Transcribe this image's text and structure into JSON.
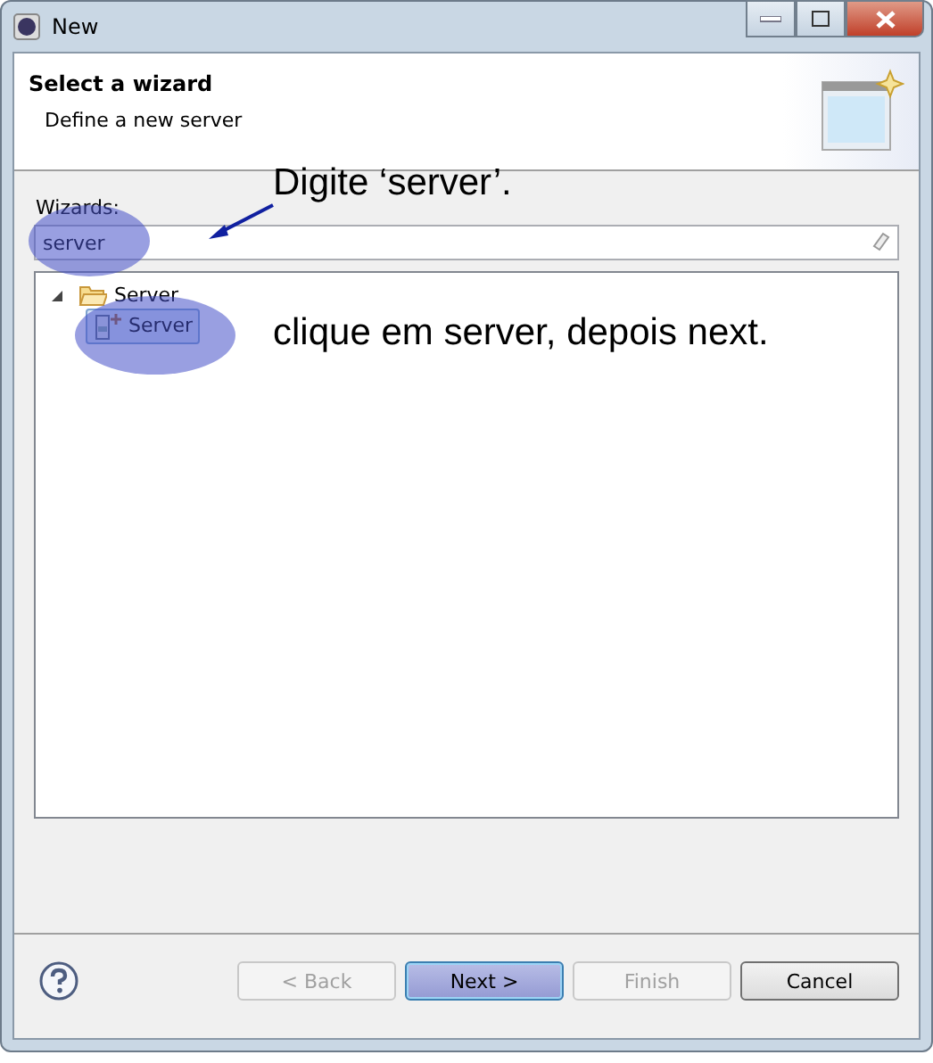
{
  "window": {
    "title": "New"
  },
  "header": {
    "title": "Select a wizard",
    "description": "Define a new server"
  },
  "wizards": {
    "label": "Wizards:",
    "search_value": "server"
  },
  "tree": [
    {
      "label": "Server",
      "expanded": true,
      "selected": false,
      "children": [
        {
          "label": "Server",
          "selected": true
        }
      ]
    }
  ],
  "annotations": [
    {
      "kind": "instruction",
      "text": "Digite ‘server’."
    },
    {
      "kind": "instruction",
      "text": "clique em server, depois next."
    }
  ],
  "buttons": [
    {
      "label": "< Back",
      "disabled": true,
      "default": false
    },
    {
      "label": "Next >",
      "disabled": false,
      "default": true
    },
    {
      "label": "Finish",
      "disabled": true,
      "default": false
    },
    {
      "label": "Cancel",
      "disabled": false,
      "default": false
    }
  ]
}
